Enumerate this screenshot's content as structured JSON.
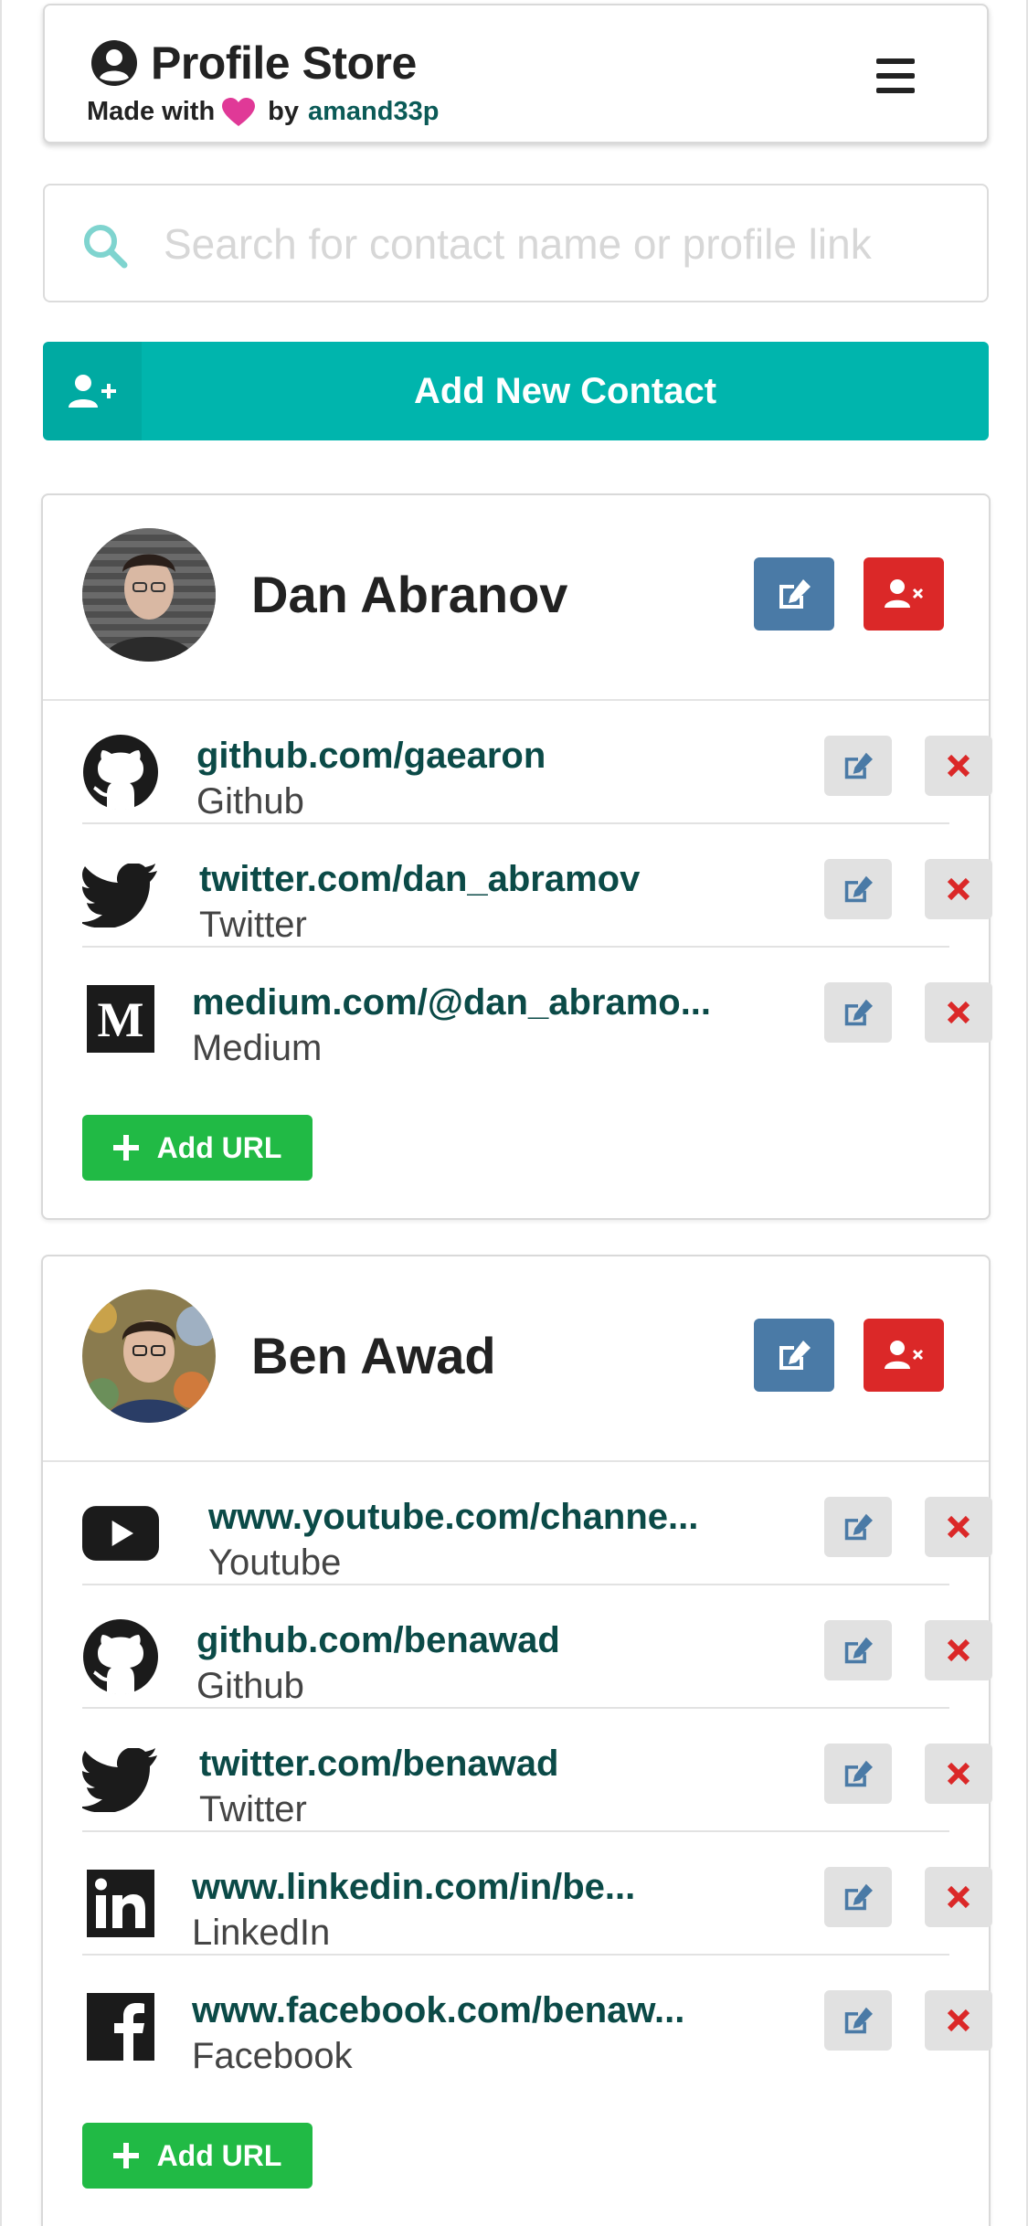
{
  "app": {
    "title": "Profile Store",
    "tagline_prefix": "Made with",
    "tagline_by": "by",
    "author": "amand33p"
  },
  "search": {
    "placeholder": "Search for contact name or profile link",
    "value": ""
  },
  "actions": {
    "add_contact_label": "Add New Contact",
    "add_url_label": "Add URL"
  },
  "colors": {
    "accent": "#00b5ad",
    "edit_blue": "#4a7aa6",
    "delete_red": "#db2828",
    "add_green": "#21ba45",
    "link_text": "#0b4a47",
    "heart": "#e03997"
  },
  "contacts": [
    {
      "name": "Dan Abranov",
      "avatar": "avatar-photo",
      "links": [
        {
          "url": "github.com/gaearon",
          "site": "Github",
          "icon": "github-icon"
        },
        {
          "url": "twitter.com/dan_abramov",
          "site": "Twitter",
          "icon": "twitter-icon"
        },
        {
          "url": "medium.com/@dan_abramo...",
          "site": "Medium",
          "icon": "medium-icon"
        }
      ]
    },
    {
      "name": "Ben Awad",
      "avatar": "avatar-photo",
      "links": [
        {
          "url": "www.youtube.com/channe...",
          "site": "Youtube",
          "icon": "youtube-icon"
        },
        {
          "url": "github.com/benawad",
          "site": "Github",
          "icon": "github-icon"
        },
        {
          "url": "twitter.com/benawad",
          "site": "Twitter",
          "icon": "twitter-icon"
        },
        {
          "url": "www.linkedin.com/in/be...",
          "site": "LinkedIn",
          "icon": "linkedin-icon"
        },
        {
          "url": "www.facebook.com/benaw...",
          "site": "Facebook",
          "icon": "facebook-icon"
        }
      ]
    }
  ]
}
